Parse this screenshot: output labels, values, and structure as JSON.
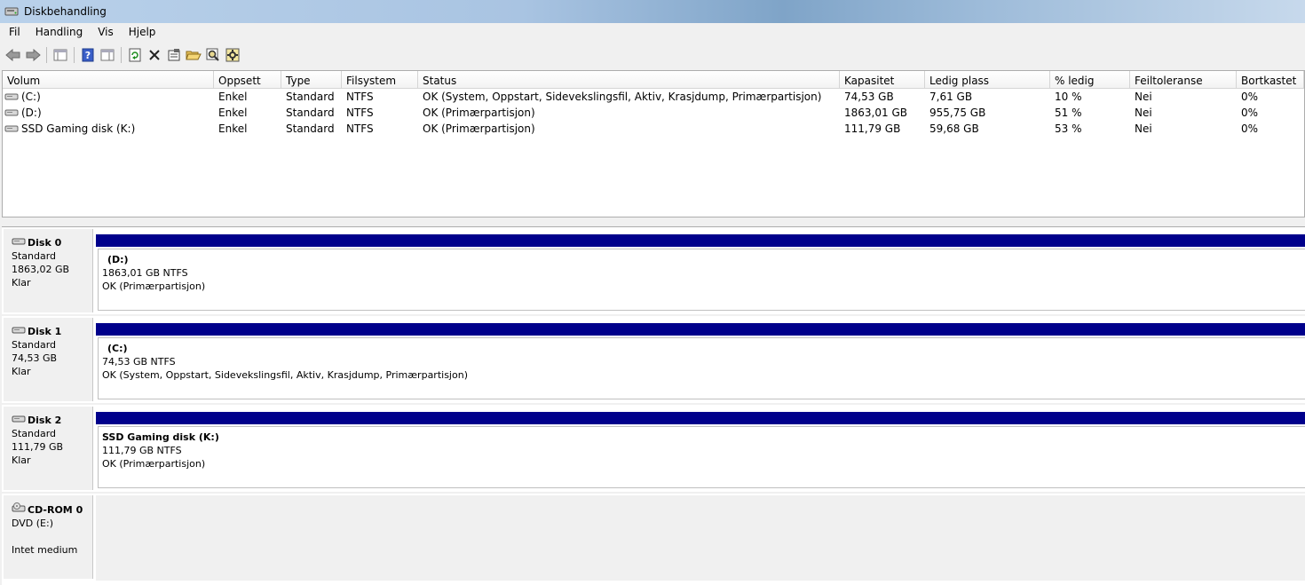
{
  "window": {
    "title": "Diskbehandling"
  },
  "menu": [
    {
      "label": "Fil"
    },
    {
      "label": "Handling"
    },
    {
      "label": "Vis"
    },
    {
      "label": "Hjelp"
    }
  ],
  "toolbar": {
    "icons": [
      "back-arrow-icon",
      "forward-arrow-icon",
      "console-tree-icon",
      "help-icon",
      "show-hide-pane-icon",
      "refresh-icon",
      "delete-icon",
      "properties-icon",
      "open-icon",
      "explore-icon",
      "settings-icon"
    ]
  },
  "volume_list": {
    "columns": [
      "Volum",
      "Oppsett",
      "Type",
      "Filsystem",
      "Status",
      "Kapasitet",
      "Ledig plass",
      "% ledig",
      "Feiltoleranse",
      "Bortkastet"
    ],
    "rows": [
      [
        "(C:)",
        "Enkel",
        "Standard",
        "NTFS",
        "OK (System, Oppstart, Sidevekslingsfil, Aktiv, Krasjdump, Primærpartisjon)",
        "74,53 GB",
        "7,61 GB",
        "10 %",
        "Nei",
        "0%"
      ],
      [
        "(D:)",
        "Enkel",
        "Standard",
        "NTFS",
        "OK (Primærpartisjon)",
        "1863,01 GB",
        "955,75 GB",
        "51 %",
        "Nei",
        "0%"
      ],
      [
        "SSD Gaming disk (K:)",
        "Enkel",
        "Standard",
        "NTFS",
        "OK (Primærpartisjon)",
        "111,79 GB",
        "59,68 GB",
        "53 %",
        "Nei",
        "0%"
      ]
    ]
  },
  "disks": [
    {
      "name": "Disk 0",
      "type": "Standard",
      "size": "1863,02 GB",
      "state": "Klar",
      "partition": {
        "name": "(D:)",
        "size": "1863,01 GB NTFS",
        "status": "OK (Primærpartisjon)"
      }
    },
    {
      "name": "Disk 1",
      "type": "Standard",
      "size": "74,53 GB",
      "state": "Klar",
      "partition": {
        "name": "(C:)",
        "size": "74,53 GB NTFS",
        "status": "OK (System, Oppstart, Sidevekslingsfil, Aktiv, Krasjdump, Primærpartisjon)"
      }
    },
    {
      "name": "Disk 2",
      "type": "Standard",
      "size": "111,79 GB",
      "state": "Klar",
      "partition": {
        "name": "SSD Gaming disk  (K:)",
        "size": "111,79 GB NTFS",
        "status": "OK (Primærpartisjon)"
      }
    }
  ],
  "cdrom": {
    "name": "CD-ROM 0",
    "drive": "DVD (E:)",
    "state": "Intet medium"
  },
  "colors": {
    "partition_bar": "#00008b",
    "panel_bg": "#f0f0f0"
  }
}
